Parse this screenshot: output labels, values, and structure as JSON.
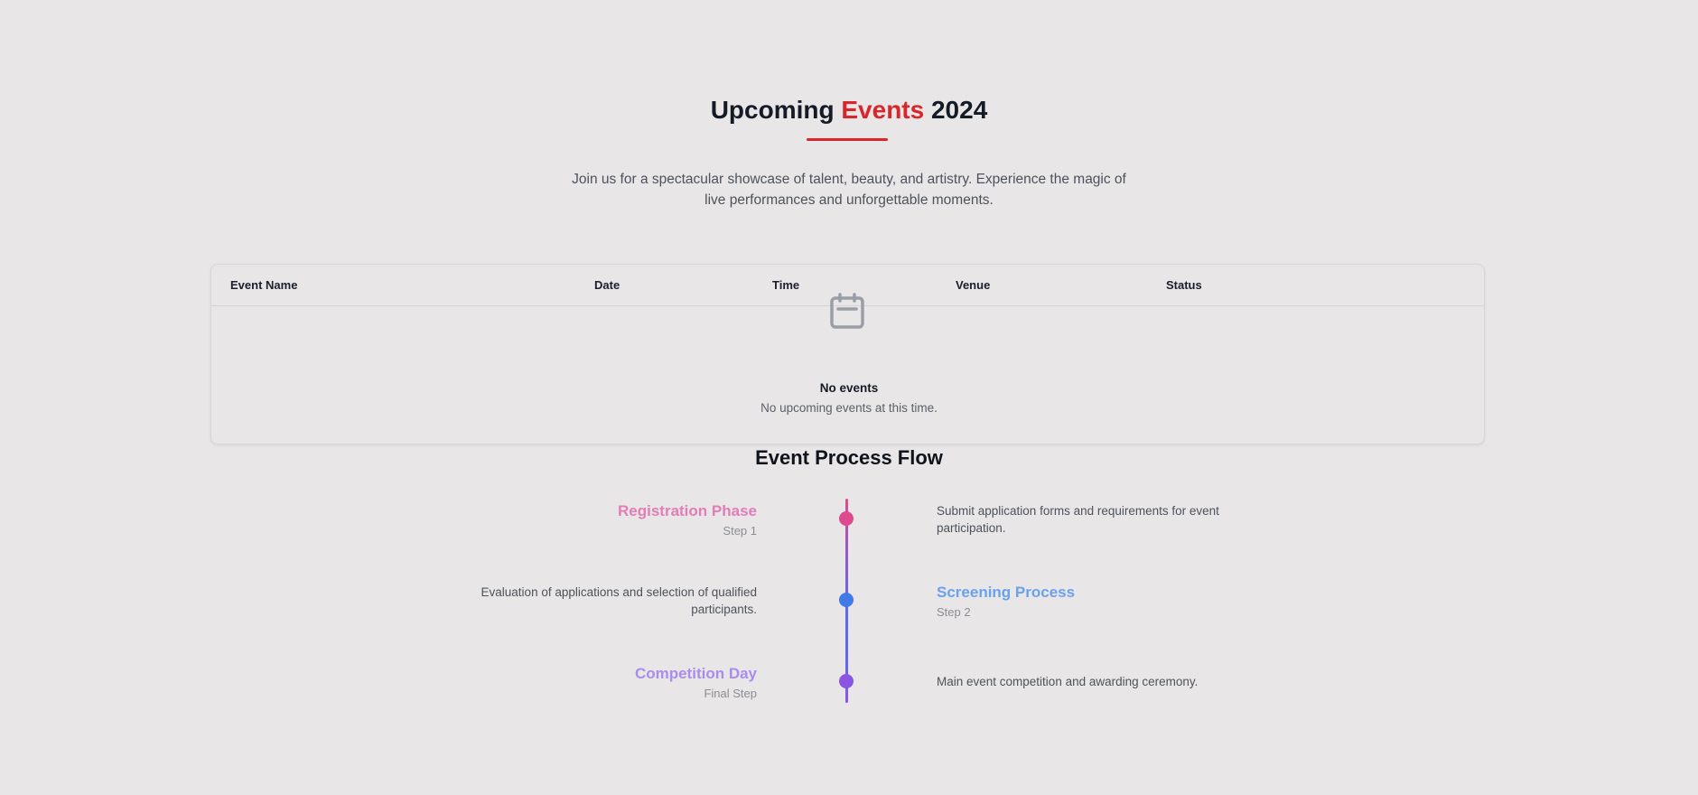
{
  "hero": {
    "title_part1": "Upcoming ",
    "title_accent": "Events",
    "title_part2": " 2024",
    "subtitle": "Join us for a spectacular showcase of talent, beauty, and artistry. Experience the magic of live performances and unforgettable moments."
  },
  "table": {
    "columns": [
      "Event Name",
      "Date",
      "Time",
      "Venue",
      "Status"
    ],
    "empty": {
      "icon": "calendar-icon",
      "title": "No events",
      "description": "No upcoming events at this time."
    }
  },
  "flow": {
    "title": "Event Process Flow",
    "steps": [
      {
        "title": "Registration Phase",
        "step": "Step 1",
        "description": "Submit application forms and requirements for event participation.",
        "color": "#e47cb6",
        "dot_color": "#dd4a8f"
      },
      {
        "title": "Screening Process",
        "step": "Step 2",
        "description": "Evaluation of applications and selection of qualified participants.",
        "color": "#6aa1ee",
        "dot_color": "#3f7ae8"
      },
      {
        "title": "Competition Day",
        "step": "Final Step",
        "description": "Main event competition and awarding ceremony.",
        "color": "#a98cec",
        "dot_color": "#8b55e3"
      }
    ]
  },
  "colors": {
    "background": "#e8e6e7",
    "accent": "#d8262a"
  }
}
